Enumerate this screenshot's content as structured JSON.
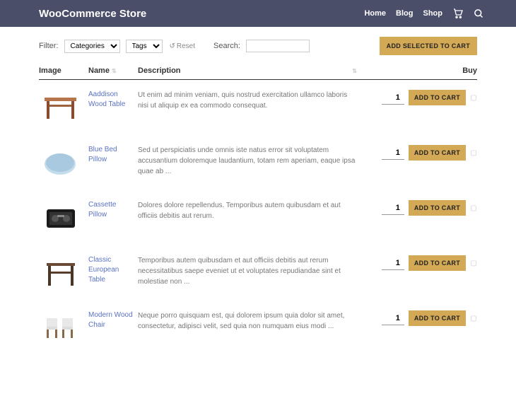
{
  "header": {
    "brand": "WooCommerce Store",
    "nav": {
      "home": "Home",
      "blog": "Blog",
      "shop": "Shop"
    }
  },
  "toolbar": {
    "filter_label": "Filter:",
    "categories_label": "Categories",
    "tags_label": "Tags",
    "reset_label": "Reset",
    "search_label": "Search:",
    "add_selected_label": "ADD SELECTED TO CART"
  },
  "table": {
    "headers": {
      "image": "Image",
      "name": "Name",
      "description": "Description",
      "buy": "Buy"
    },
    "add_to_cart_label": "ADD TO CART",
    "rows": [
      {
        "name": "Aaddison Wood Table",
        "description": "Ut enim ad minim veniam, quis nostrud exercitation ullamco laboris nisi ut aliquip ex ea commodo consequat.",
        "qty": "1"
      },
      {
        "name": "Blue Bed Pillow",
        "description": "Sed ut perspiciatis unde omnis iste natus error sit voluptatem accusantium doloremque laudantium, totam rem aperiam, eaque ipsa quae ab ...",
        "qty": "1"
      },
      {
        "name": "Cassette Pillow",
        "description": "Dolores dolore repellendus. Temporibus autem quibusdam et aut officiis debitis aut rerum.",
        "qty": "1"
      },
      {
        "name": "Classic European Table",
        "description": "Temporibus autem quibusdam et aut officiis debitis aut rerum necessitatibus saepe eveniet ut et voluptates repudiandae sint et molestiae non ...",
        "qty": "1"
      },
      {
        "name": "Modern Wood Chair",
        "description": "Neque porro quisquam est, qui dolorem ipsum quia dolor sit amet, consectetur, adipisci velit, sed quia non numquam eius modi ...",
        "qty": "1"
      }
    ]
  }
}
